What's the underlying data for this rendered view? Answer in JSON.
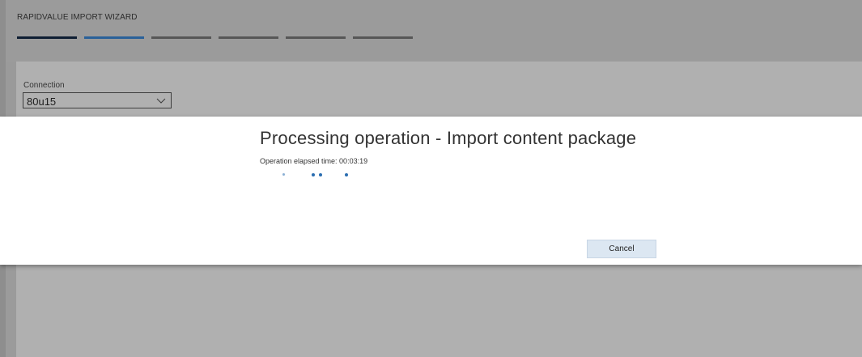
{
  "wizard": {
    "title": "RAPIDVALUE IMPORT WIZARD",
    "steps": [
      "completed",
      "current",
      "pending",
      "pending",
      "pending",
      "pending"
    ]
  },
  "connection": {
    "label": "Connection",
    "value": "80u15",
    "icon": "chevron-down-icon"
  },
  "modal": {
    "title": "Processing operation - Import content package",
    "elapsed_text": "Operation elapsed time: 00:03:19",
    "cancel_label": "Cancel"
  },
  "colors": {
    "step_completed": "#0f1f33",
    "step_current": "#2a6199",
    "step_pending": "#575757",
    "loader_dot": "#2a6db0",
    "cancel_bg": "#dce7f2"
  }
}
